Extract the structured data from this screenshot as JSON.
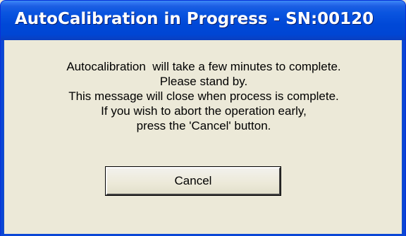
{
  "window": {
    "title": "AutoCalibration in Progress - SN:00120"
  },
  "message": {
    "lines": [
      "Autocalibration  will take a few minutes to complete.",
      "Please stand by.",
      "This message will close when process is complete.",
      "If you wish to abort the operation early,",
      "press the 'Cancel' button."
    ]
  },
  "buttons": {
    "cancel_label": "Cancel"
  },
  "colors": {
    "titlebar": "#0054E3",
    "window_face": "#ECE9D8",
    "title_text": "#FFFFFF"
  }
}
